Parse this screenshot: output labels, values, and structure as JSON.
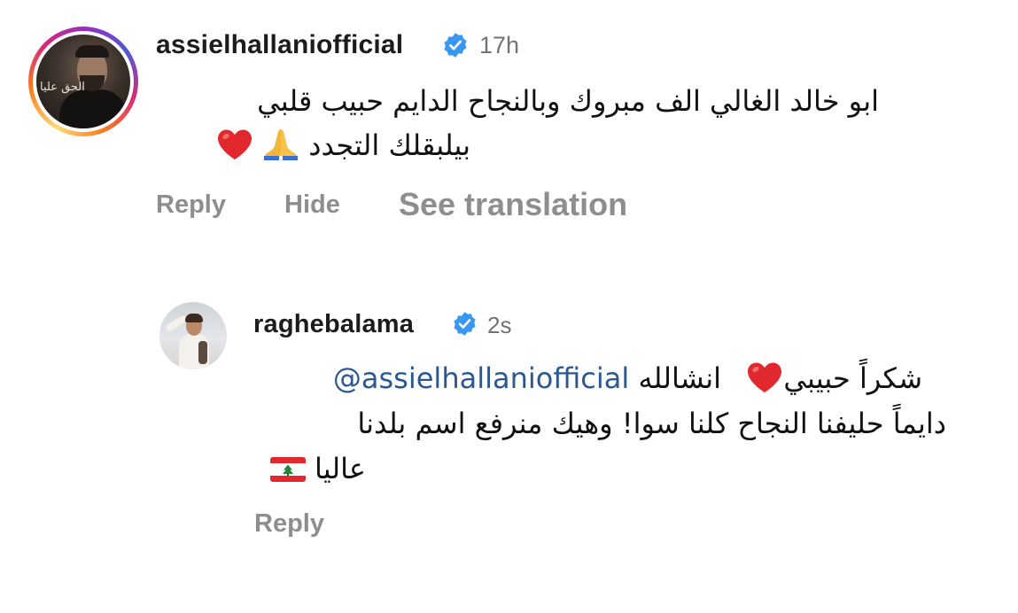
{
  "comment": {
    "username": "assielhallanio​fficial",
    "verified": true,
    "time": "17h",
    "avatar_caption": "الحق عليا",
    "body_line1": "ابو خالد الغالي الف مبروك وبالنجاح الدايم حبيب قلبي",
    "body_line2": "بيلبقلك التجدد",
    "emoji_line2": [
      "folded-hands",
      "red-heart"
    ],
    "actions": {
      "reply": "Reply",
      "hide": "Hide",
      "see_translation": "See translation"
    }
  },
  "reply": {
    "username": "raghebalama",
    "verified": true,
    "time": "2s",
    "body_line1_text1": "شكراً حبيبي",
    "body_line1_text2": "انشالله",
    "mention": "@assielhallanio​fficial",
    "body_line2": "دايماً حليفنا النجاح كلنا سوا! وهيك منرفع اسم بلدنا",
    "body_line3": "عاليا",
    "emoji": [
      "red-heart",
      "lebanon-flag"
    ],
    "actions": {
      "reply": "Reply"
    }
  },
  "colors": {
    "verified_blue": "#3897f0",
    "meta_gray": "#737373",
    "action_gray": "#8e8e8e",
    "mention_blue": "#2b5891",
    "heart_red": "#e0282e"
  }
}
